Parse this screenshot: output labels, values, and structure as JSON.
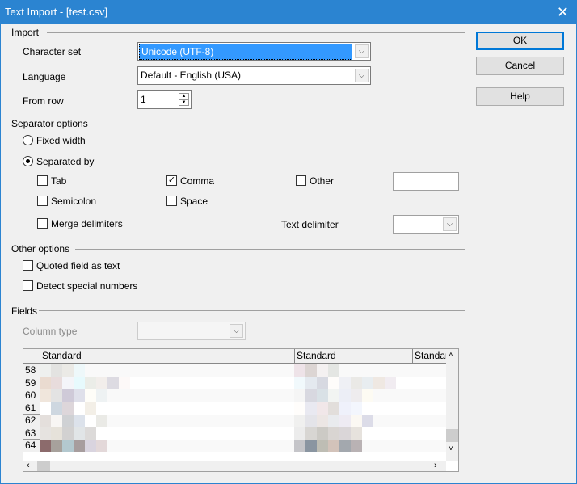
{
  "window": {
    "title": "Text Import - [test.csv]",
    "close": "✕"
  },
  "buttons": {
    "ok": "OK",
    "cancel": "Cancel",
    "help": "Help"
  },
  "import": {
    "section": "Import",
    "charset_label": "Character set",
    "charset_value": "Unicode (UTF-8)",
    "language_label": "Language",
    "language_value": "Default - English (USA)",
    "fromrow_label": "From row",
    "fromrow_value": "1"
  },
  "separator": {
    "section": "Separator options",
    "fixed_width": "Fixed width",
    "separated_by": "Separated by",
    "mode": "separated",
    "tab": {
      "label": "Tab",
      "checked": false
    },
    "comma": {
      "label": "Comma",
      "checked": true
    },
    "other": {
      "label": "Other",
      "checked": false,
      "value": ""
    },
    "semicolon": {
      "label": "Semicolon",
      "checked": false
    },
    "space": {
      "label": "Space",
      "checked": false
    },
    "merge": {
      "label": "Merge delimiters",
      "checked": false
    },
    "text_delimiter_label": "Text delimiter",
    "text_delimiter_value": ""
  },
  "other_options": {
    "section": "Other options",
    "quoted": {
      "label": "Quoted field as text",
      "checked": false
    },
    "detect": {
      "label": "Detect special numbers",
      "checked": false
    }
  },
  "fields": {
    "section": "Fields",
    "column_type_label": "Column type",
    "column_type_value": "",
    "columns": [
      "Standard",
      "Standard",
      "Standar"
    ],
    "rows": [
      "58",
      "59",
      "60",
      "61",
      "62",
      "63",
      "64"
    ],
    "pixels_col1": [
      [
        "#eef0ee",
        "#e3e3e1",
        "#ebeae6",
        "#eef8fa"
      ],
      [
        "#eadbd0",
        "#e8dcdc",
        "#f4f5f9",
        "#e7fafd",
        "#ebede8",
        "#f2eeeb",
        "#dddbe2",
        "#fdf9f8"
      ],
      [
        "#f0e6dc",
        "#e3e3e3",
        "#cfcad8",
        "#dfe0ea",
        "#fefdf8",
        "#eef2f3"
      ],
      [
        "#ffffff",
        "#ced7e0",
        "#ddd6da",
        "#ffffff",
        "#f3efe7"
      ],
      [
        "#e4dfdc",
        "#f8f6f4",
        "#cfd1d4",
        "#dce2eb",
        "#ffffff",
        "#eaeae6"
      ],
      [
        "#e6e3e0",
        "#e6e2da",
        "#d2d1d1",
        "#e1e5e7",
        "#dcdad9"
      ],
      [
        "#8c6b6c",
        "#a7a19c",
        "#b3c8cf",
        "#a79d9e",
        "#d9d4df",
        "#e3d8d9"
      ]
    ],
    "pixels_col2": [
      [
        "#eee3e8",
        "#dcd5d3",
        "#f4f1f1",
        "#e4e6e3"
      ],
      [
        "#f1f9fc",
        "#e4e9ef",
        "#d7d9e1",
        "#fefcfa",
        "#eff0f5",
        "#eae9e6",
        "#e8edf0",
        "#efe8e2",
        "#f1ecf1"
      ],
      [
        "#f5f5f5",
        "#d8d8e0",
        "#d9e1e6",
        "#f2f4f2",
        "#eceef6",
        "#eeecee",
        "#fdfbf3"
      ],
      [
        "#fffdfb",
        "#e9e9f1",
        "#f1e7e9",
        "#e2dedb",
        "#eff1fb",
        "#f3f6fd"
      ],
      [
        "#f0f0ef",
        "#e4e4e9",
        "#ece6e4",
        "#e9ebee",
        "#eeebf3",
        "#fbf8f3",
        "#dcdce8"
      ],
      [
        "#ececec",
        "#d8d6d3",
        "#cccac5",
        "#d9d5d2",
        "#dad6d8",
        "#e6e2dd"
      ],
      [
        "#c5c5c9",
        "#8a95a1",
        "#bebdb4",
        "#d3c3ba",
        "#a3a8ae",
        "#b9b2b4"
      ]
    ]
  }
}
